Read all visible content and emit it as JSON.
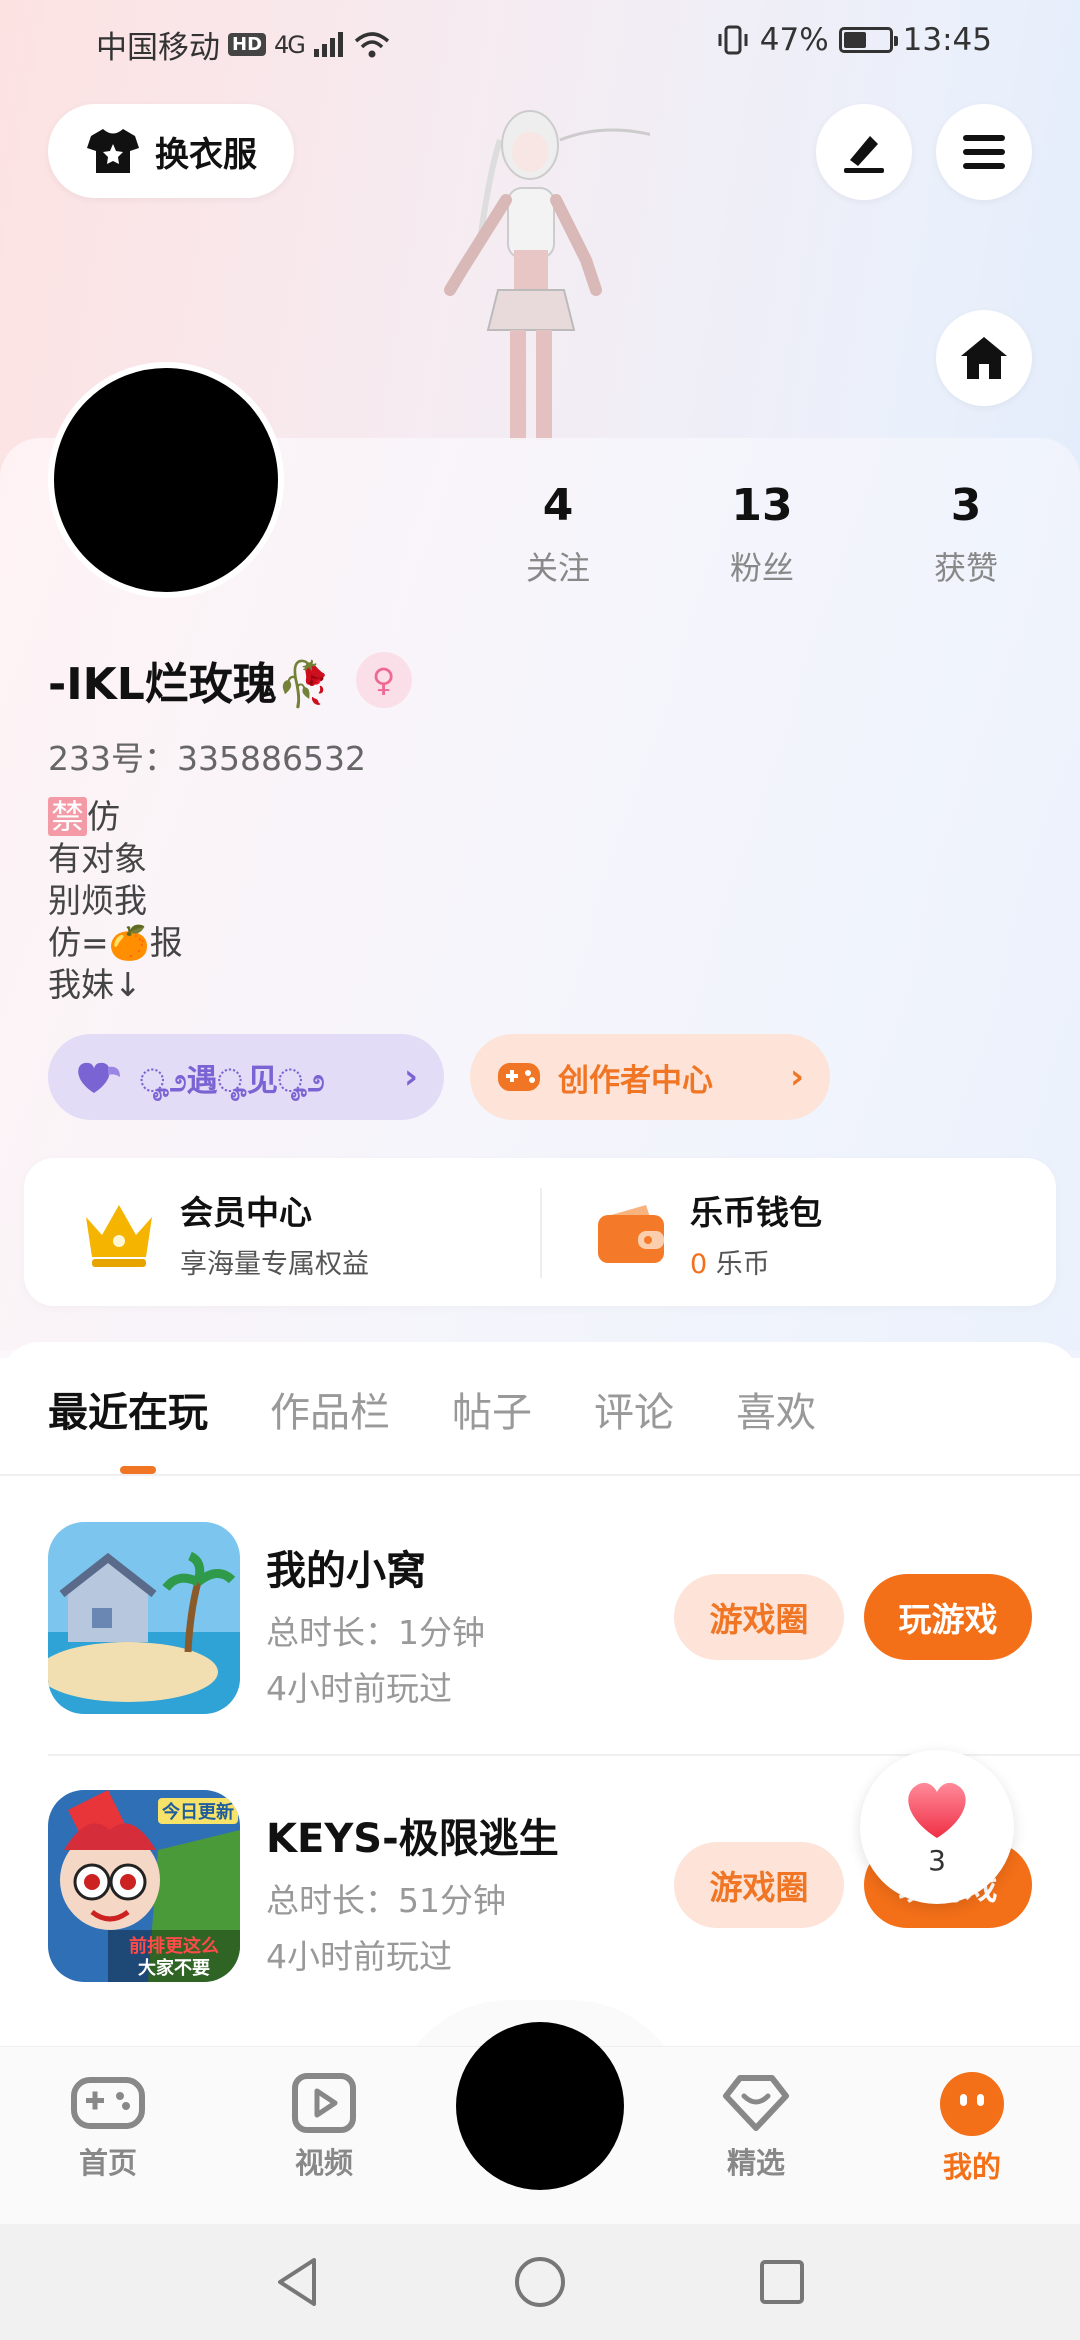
{
  "status_bar": {
    "carrier": "中国移动",
    "hd": "HD",
    "network": "4G",
    "battery": "47%",
    "time": "13:45"
  },
  "header": {
    "outfit_label": "换衣服"
  },
  "profile": {
    "username": "-IKL烂玫瑰🥀",
    "gender_symbol": "♀",
    "uid": "233号：335886532",
    "bio": [
      "仿",
      "有对象",
      "别烦我",
      "仿=🍊报",
      "我妹↓"
    ],
    "bio_tag": "禁",
    "stats": [
      {
        "count": "4",
        "label": "关注"
      },
      {
        "count": "13",
        "label": "粉丝"
      },
      {
        "count": "3",
        "label": "获赞"
      }
    ]
  },
  "pills": {
    "meet_label": "ೄ೨遇ೄ见ೄ೨",
    "creator_label": "创作者中心"
  },
  "member": {
    "vip_title": "会员中心",
    "vip_sub": "享海量专属权益",
    "wallet_title": "乐币钱包",
    "wallet_amount": "0",
    "wallet_unit": "乐币"
  },
  "tabs": [
    "最近在玩",
    "作品栏",
    "帖子",
    "评论",
    "喜欢"
  ],
  "games": [
    {
      "title": "我的小窝",
      "duration": "总时长：1分钟",
      "last_played": "4小时前玩过",
      "circle_label": "游戏圈",
      "play_label": "玩游戏"
    },
    {
      "title": "KEYS-极限逃生",
      "duration": "总时长：51分钟",
      "last_played": "4小时前玩过",
      "circle_label": "游戏圈",
      "play_label": "玩游戏",
      "icon_text_1": "今日更新",
      "icon_text_2": "前排更这么",
      "icon_text_3": "大家不要"
    }
  ],
  "like_float": {
    "count": "3"
  },
  "bottom_nav": [
    {
      "label": "首页"
    },
    {
      "label": "视频"
    },
    {
      "label": "精选"
    },
    {
      "label": "我的"
    }
  ],
  "colors": {
    "accent": "#f36f18",
    "purple": "#7a64d4",
    "gold": "#f5b400"
  }
}
